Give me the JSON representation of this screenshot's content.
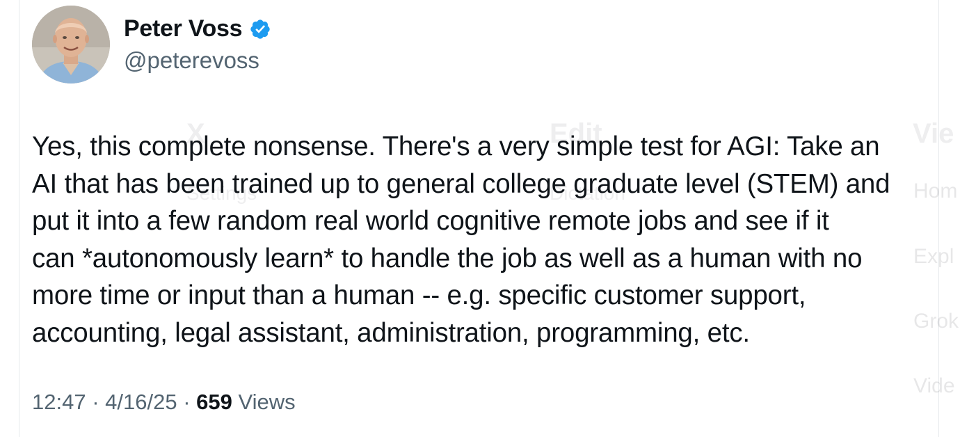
{
  "author": {
    "name": "Peter Voss",
    "handle": "@peterevoss",
    "verified_color": "#1d9bf0"
  },
  "tweet": {
    "lines": [
      "Yes, this complete nonsense. There's a very simple test for AGI: Take an",
      "AI that has been trained up to general college graduate level (STEM) and",
      "put it into a few random real world cognitive remote jobs and see if it",
      "can *autonomously learn* to handle the job as well as a human with no",
      "more time or input than a human -- e.g.  specific customer support,",
      "accounting, legal assistant, administration, programming, etc."
    ]
  },
  "meta": {
    "time": "12:47",
    "sep1": " · ",
    "date": "4/16/25",
    "sep2": " · ",
    "views_count": "659",
    "views_label": " Views"
  },
  "background": {
    "menu_x": "X",
    "menu_edit": "Edit",
    "menu_view": "Vie",
    "settings": "Settings",
    "dictation": "Dictation",
    "side_home": "Hom",
    "side_explore": "Expl",
    "side_grok": "Grok",
    "side_video": "Vide"
  }
}
